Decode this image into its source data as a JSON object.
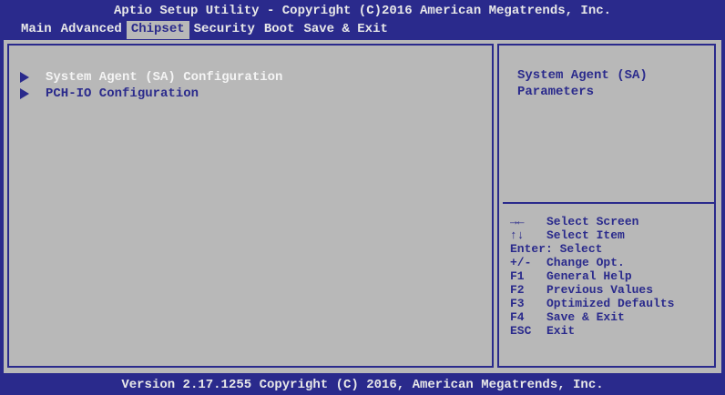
{
  "title": "Aptio Setup Utility - Copyright (C)2016 American Megatrends, Inc.",
  "menu": [
    {
      "label": "Main",
      "active": false
    },
    {
      "label": "Advanced",
      "active": false
    },
    {
      "label": "Chipset",
      "active": true
    },
    {
      "label": "Security",
      "active": false
    },
    {
      "label": "Boot",
      "active": false
    },
    {
      "label": "Save & Exit",
      "active": false
    }
  ],
  "items": [
    {
      "label": "System Agent (SA) Configuration",
      "selected": true
    },
    {
      "label": "PCH-IO Configuration",
      "selected": false
    }
  ],
  "help_text": "System Agent (SA) Parameters",
  "keys": [
    {
      "key": "→←",
      "desc": "Select Screen"
    },
    {
      "key": "↑↓",
      "desc": "Select Item"
    },
    {
      "key": "Enter:",
      "desc": "Select"
    },
    {
      "key": "+/-",
      "desc": "Change Opt."
    },
    {
      "key": "F1",
      "desc": "General Help"
    },
    {
      "key": "F2",
      "desc": "Previous Values"
    },
    {
      "key": "F3",
      "desc": "Optimized Defaults"
    },
    {
      "key": "F4",
      "desc": "Save & Exit"
    },
    {
      "key": "ESC",
      "desc": "Exit"
    }
  ],
  "footer": "Version 2.17.1255 Copyright (C) 2016, American Megatrends, Inc.",
  "colors": {
    "background": "#2a2a8c",
    "panel": "#b8b8b8",
    "selected_text": "#f4f4f4"
  }
}
